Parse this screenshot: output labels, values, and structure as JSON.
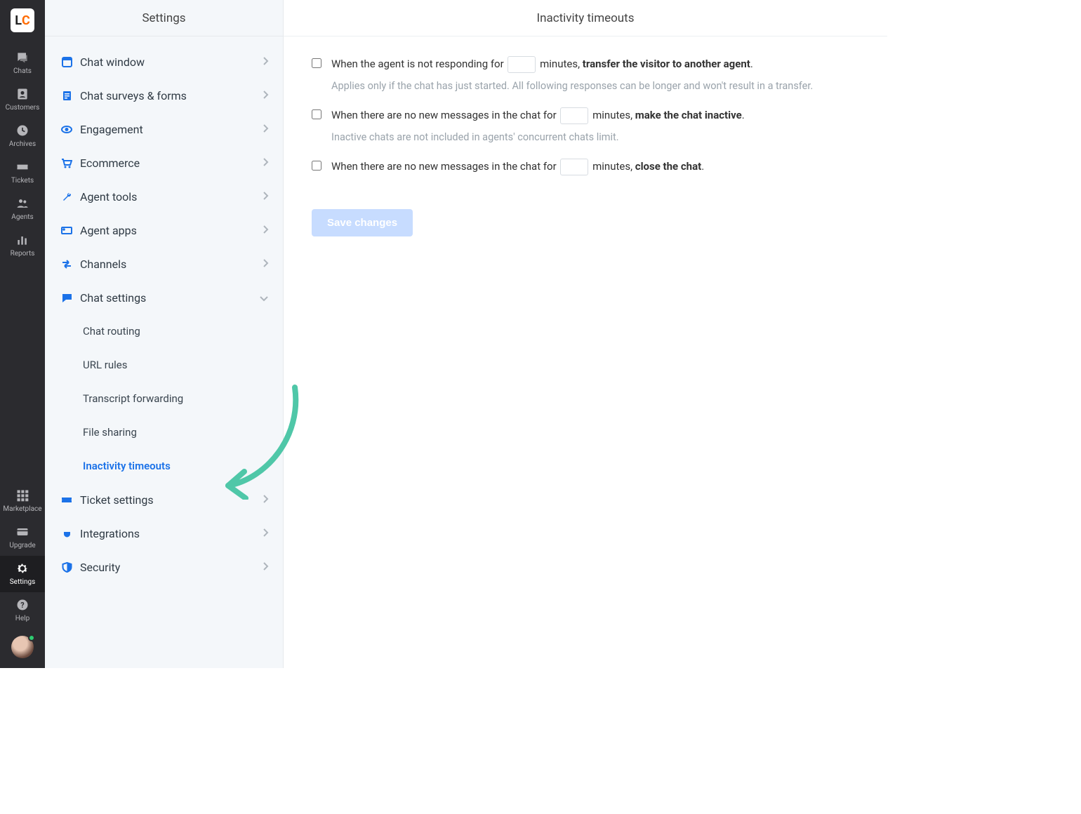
{
  "rail": {
    "logo": {
      "l": "L",
      "c": "C"
    },
    "top": [
      {
        "name": "chats",
        "label": "Chats",
        "icon": "chat-icon"
      },
      {
        "name": "customers",
        "label": "Customers",
        "icon": "customer-icon"
      },
      {
        "name": "archives",
        "label": "Archives",
        "icon": "clock-icon"
      },
      {
        "name": "tickets",
        "label": "Tickets",
        "icon": "ticket-icon"
      },
      {
        "name": "agents",
        "label": "Agents",
        "icon": "people-icon"
      },
      {
        "name": "reports",
        "label": "Reports",
        "icon": "bar-chart-icon"
      }
    ],
    "bottom": [
      {
        "name": "marketplace",
        "label": "Marketplace",
        "icon": "grid-icon"
      },
      {
        "name": "upgrade",
        "label": "Upgrade",
        "icon": "card-icon"
      },
      {
        "name": "settings",
        "label": "Settings",
        "icon": "gear-icon",
        "active": true
      },
      {
        "name": "help",
        "label": "Help",
        "icon": "question-icon"
      }
    ]
  },
  "sidebar": {
    "title": "Settings",
    "items": [
      {
        "label": "Chat window",
        "icon": "window-icon"
      },
      {
        "label": "Chat surveys & forms",
        "icon": "form-icon"
      },
      {
        "label": "Engagement",
        "icon": "eye-icon"
      },
      {
        "label": "Ecommerce",
        "icon": "cart-icon"
      },
      {
        "label": "Agent tools",
        "icon": "wrench-icon"
      },
      {
        "label": "Agent apps",
        "icon": "apps-icon"
      },
      {
        "label": "Channels",
        "icon": "channels-icon"
      },
      {
        "label": "Chat settings",
        "icon": "chat-settings-icon",
        "expanded": true,
        "children": [
          {
            "label": "Chat routing"
          },
          {
            "label": "URL rules"
          },
          {
            "label": "Transcript forwarding"
          },
          {
            "label": "File sharing"
          },
          {
            "label": "Inactivity timeouts",
            "active": true
          }
        ]
      },
      {
        "label": "Ticket settings",
        "icon": "ticket-settings-icon"
      },
      {
        "label": "Integrations",
        "icon": "plug-icon"
      },
      {
        "label": "Security",
        "icon": "shield-icon"
      }
    ]
  },
  "main": {
    "title": "Inactivity timeouts",
    "opts": [
      {
        "pre": "When the agent is not responding for ",
        "value": "",
        "mid": " minutes, ",
        "bold": "transfer the visitor to another agent",
        "post": ".",
        "help": "Applies only if the chat has just started. All following responses can be longer and won't result in a transfer."
      },
      {
        "pre": "When there are no new messages in the chat for ",
        "value": "",
        "mid": " minutes, ",
        "bold": "make the chat inactive",
        "post": ".",
        "help": "Inactive chats are not included in agents' concurrent chats limit."
      },
      {
        "pre": "When there are no new messages in the chat for ",
        "value": "",
        "mid": " minutes, ",
        "bold": "close the chat",
        "post": "."
      }
    ],
    "save_label": "Save changes"
  },
  "icons": {
    "chat-icon": "💬",
    "customer-icon": "👤",
    "clock-icon": "🕘",
    "ticket-icon": "🎫",
    "people-icon": "👥",
    "bar-chart-icon": "📊",
    "grid-icon": "▦",
    "card-icon": "💳",
    "gear-icon": "⚙",
    "question-icon": "?",
    "window-icon": "▢",
    "form-icon": "📄",
    "eye-icon": "👁",
    "cart-icon": "🛒",
    "wrench-icon": "🔧",
    "apps-icon": "▭",
    "channels-icon": "⇄",
    "chat-settings-icon": "💬",
    "ticket-settings-icon": "🎟",
    "plug-icon": "🔌",
    "shield-icon": "🛡"
  }
}
